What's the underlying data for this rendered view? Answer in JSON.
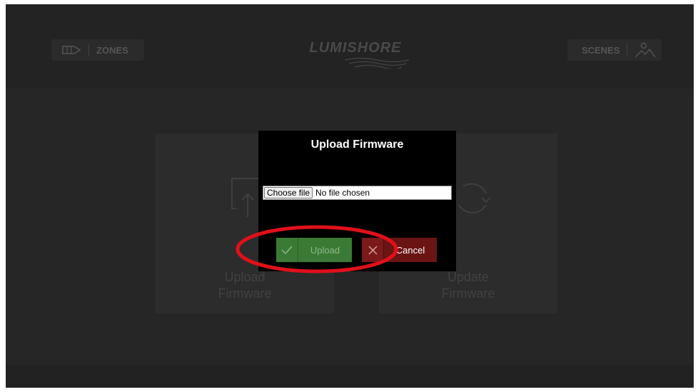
{
  "header": {
    "zones_label": "ZONES",
    "scenes_label": "SCENES",
    "logo_text": "LUMISHORE"
  },
  "tiles": [
    {
      "label_line1": "Upload",
      "label_line2": "Firmware",
      "icon": "upload-icon"
    },
    {
      "label_line1": "Update",
      "label_line2": "Firmware",
      "icon": "refresh-icon"
    }
  ],
  "dialog": {
    "title": "Upload Firmware",
    "choose_file_label": "Choose file",
    "file_status": "No file chosen",
    "upload_label": "Upload",
    "cancel_label": "Cancel"
  },
  "colors": {
    "upload_button": "#3b7a34",
    "cancel_button": "#6b1414",
    "annotation": "#e0101a"
  }
}
